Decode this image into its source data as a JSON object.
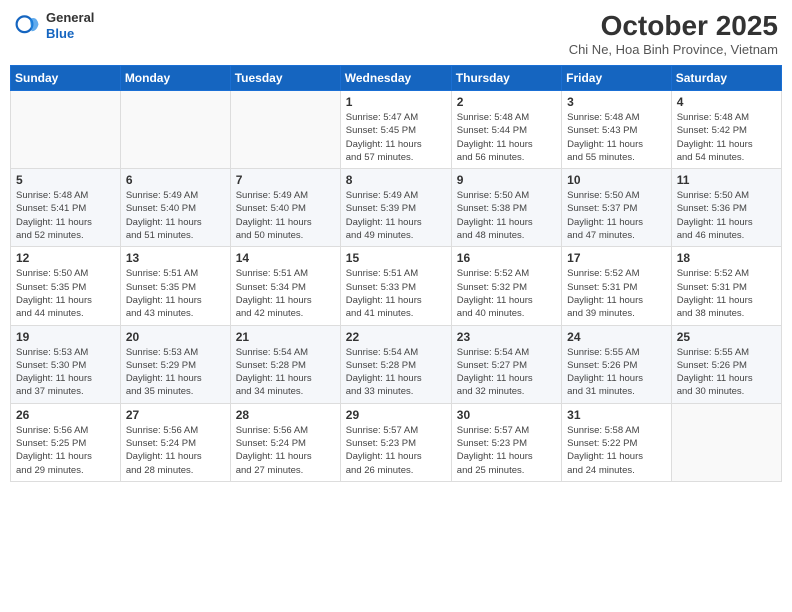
{
  "header": {
    "logo_line1": "General",
    "logo_line2": "Blue",
    "month_title": "October 2025",
    "location": "Chi Ne, Hoa Binh Province, Vietnam"
  },
  "weekdays": [
    "Sunday",
    "Monday",
    "Tuesday",
    "Wednesday",
    "Thursday",
    "Friday",
    "Saturday"
  ],
  "weeks": [
    [
      {
        "day": "",
        "info": ""
      },
      {
        "day": "",
        "info": ""
      },
      {
        "day": "",
        "info": ""
      },
      {
        "day": "1",
        "info": "Sunrise: 5:47 AM\nSunset: 5:45 PM\nDaylight: 11 hours\nand 57 minutes."
      },
      {
        "day": "2",
        "info": "Sunrise: 5:48 AM\nSunset: 5:44 PM\nDaylight: 11 hours\nand 56 minutes."
      },
      {
        "day": "3",
        "info": "Sunrise: 5:48 AM\nSunset: 5:43 PM\nDaylight: 11 hours\nand 55 minutes."
      },
      {
        "day": "4",
        "info": "Sunrise: 5:48 AM\nSunset: 5:42 PM\nDaylight: 11 hours\nand 54 minutes."
      }
    ],
    [
      {
        "day": "5",
        "info": "Sunrise: 5:48 AM\nSunset: 5:41 PM\nDaylight: 11 hours\nand 52 minutes."
      },
      {
        "day": "6",
        "info": "Sunrise: 5:49 AM\nSunset: 5:40 PM\nDaylight: 11 hours\nand 51 minutes."
      },
      {
        "day": "7",
        "info": "Sunrise: 5:49 AM\nSunset: 5:40 PM\nDaylight: 11 hours\nand 50 minutes."
      },
      {
        "day": "8",
        "info": "Sunrise: 5:49 AM\nSunset: 5:39 PM\nDaylight: 11 hours\nand 49 minutes."
      },
      {
        "day": "9",
        "info": "Sunrise: 5:50 AM\nSunset: 5:38 PM\nDaylight: 11 hours\nand 48 minutes."
      },
      {
        "day": "10",
        "info": "Sunrise: 5:50 AM\nSunset: 5:37 PM\nDaylight: 11 hours\nand 47 minutes."
      },
      {
        "day": "11",
        "info": "Sunrise: 5:50 AM\nSunset: 5:36 PM\nDaylight: 11 hours\nand 46 minutes."
      }
    ],
    [
      {
        "day": "12",
        "info": "Sunrise: 5:50 AM\nSunset: 5:35 PM\nDaylight: 11 hours\nand 44 minutes."
      },
      {
        "day": "13",
        "info": "Sunrise: 5:51 AM\nSunset: 5:35 PM\nDaylight: 11 hours\nand 43 minutes."
      },
      {
        "day": "14",
        "info": "Sunrise: 5:51 AM\nSunset: 5:34 PM\nDaylight: 11 hours\nand 42 minutes."
      },
      {
        "day": "15",
        "info": "Sunrise: 5:51 AM\nSunset: 5:33 PM\nDaylight: 11 hours\nand 41 minutes."
      },
      {
        "day": "16",
        "info": "Sunrise: 5:52 AM\nSunset: 5:32 PM\nDaylight: 11 hours\nand 40 minutes."
      },
      {
        "day": "17",
        "info": "Sunrise: 5:52 AM\nSunset: 5:31 PM\nDaylight: 11 hours\nand 39 minutes."
      },
      {
        "day": "18",
        "info": "Sunrise: 5:52 AM\nSunset: 5:31 PM\nDaylight: 11 hours\nand 38 minutes."
      }
    ],
    [
      {
        "day": "19",
        "info": "Sunrise: 5:53 AM\nSunset: 5:30 PM\nDaylight: 11 hours\nand 37 minutes."
      },
      {
        "day": "20",
        "info": "Sunrise: 5:53 AM\nSunset: 5:29 PM\nDaylight: 11 hours\nand 35 minutes."
      },
      {
        "day": "21",
        "info": "Sunrise: 5:54 AM\nSunset: 5:28 PM\nDaylight: 11 hours\nand 34 minutes."
      },
      {
        "day": "22",
        "info": "Sunrise: 5:54 AM\nSunset: 5:28 PM\nDaylight: 11 hours\nand 33 minutes."
      },
      {
        "day": "23",
        "info": "Sunrise: 5:54 AM\nSunset: 5:27 PM\nDaylight: 11 hours\nand 32 minutes."
      },
      {
        "day": "24",
        "info": "Sunrise: 5:55 AM\nSunset: 5:26 PM\nDaylight: 11 hours\nand 31 minutes."
      },
      {
        "day": "25",
        "info": "Sunrise: 5:55 AM\nSunset: 5:26 PM\nDaylight: 11 hours\nand 30 minutes."
      }
    ],
    [
      {
        "day": "26",
        "info": "Sunrise: 5:56 AM\nSunset: 5:25 PM\nDaylight: 11 hours\nand 29 minutes."
      },
      {
        "day": "27",
        "info": "Sunrise: 5:56 AM\nSunset: 5:24 PM\nDaylight: 11 hours\nand 28 minutes."
      },
      {
        "day": "28",
        "info": "Sunrise: 5:56 AM\nSunset: 5:24 PM\nDaylight: 11 hours\nand 27 minutes."
      },
      {
        "day": "29",
        "info": "Sunrise: 5:57 AM\nSunset: 5:23 PM\nDaylight: 11 hours\nand 26 minutes."
      },
      {
        "day": "30",
        "info": "Sunrise: 5:57 AM\nSunset: 5:23 PM\nDaylight: 11 hours\nand 25 minutes."
      },
      {
        "day": "31",
        "info": "Sunrise: 5:58 AM\nSunset: 5:22 PM\nDaylight: 11 hours\nand 24 minutes."
      },
      {
        "day": "",
        "info": ""
      }
    ]
  ]
}
